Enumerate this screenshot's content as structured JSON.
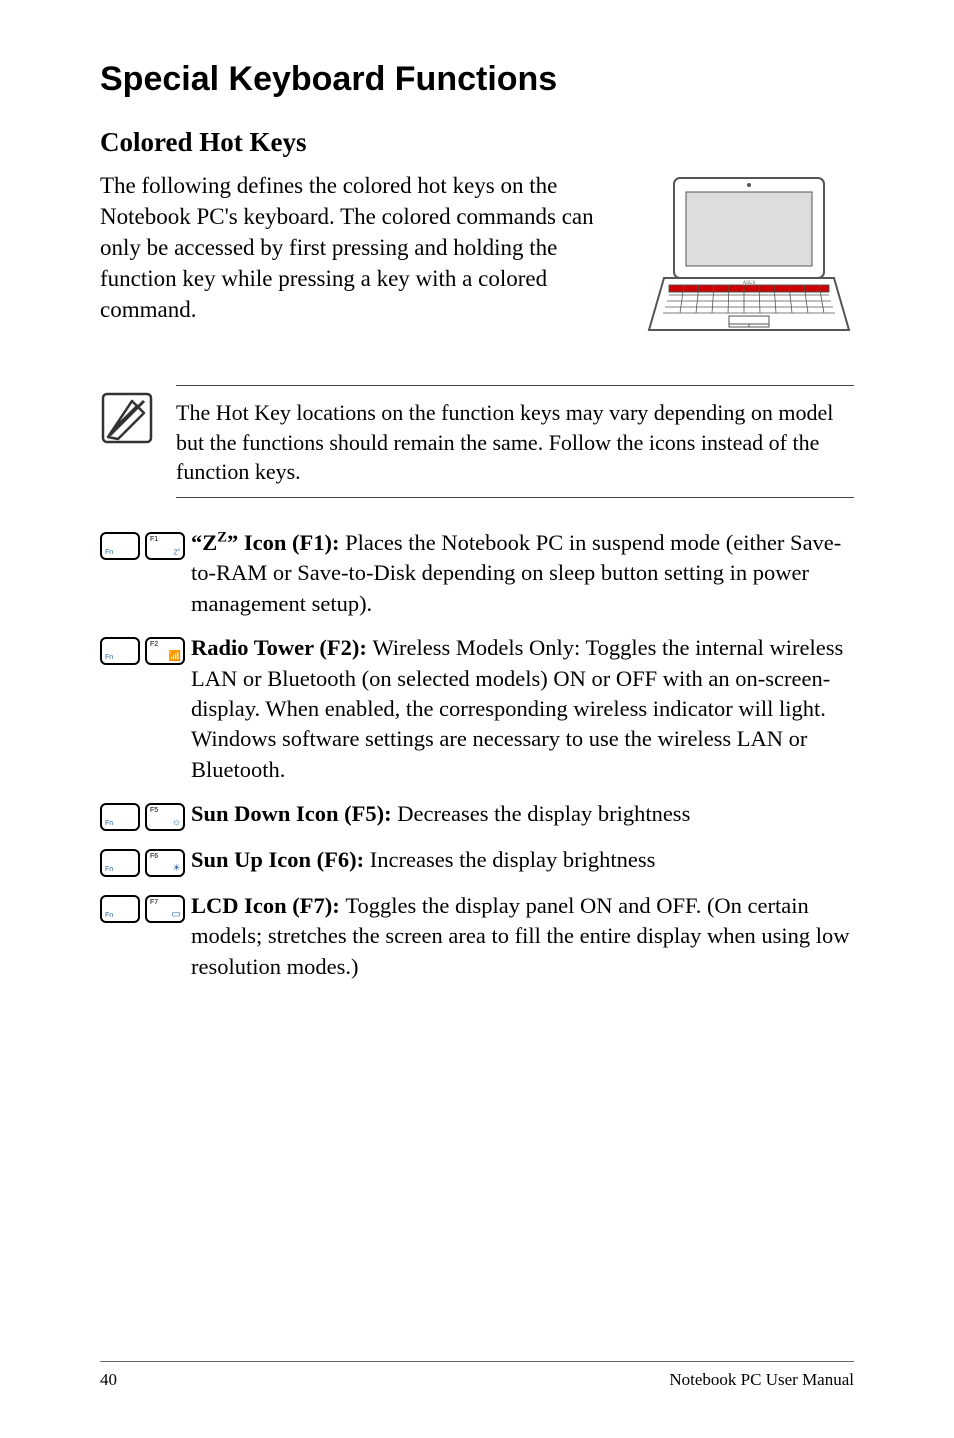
{
  "title": "Special Keyboard Functions",
  "subtitle": "Colored Hot Keys",
  "intro": "The following defines the colored hot keys on the Notebook PC's keyboard. The colored commands can only be accessed by first pressing and holding the function key while pressing a key with a colored command.",
  "note": "The Hot Key locations on the function keys may vary depending on model but the functions should remain the same. Follow the icons instead of the function keys.",
  "entries": {
    "f1": {
      "label": "F1",
      "sym": "Z",
      "bold": "\"ZZ\" Icon (F1): ",
      "text": "Places the Notebook PC in suspend mode (either Save-to-RAM or Save-to-Disk depending on sleep button setting in power management setup)."
    },
    "f2": {
      "label": "F2",
      "sym": "📡",
      "bold": "Radio Tower (F2): ",
      "text": "Wireless Models Only: Toggles the internal wireless LAN or Bluetooth (on selected models) ON or OFF with an on-screen-display. When enabled, the corresponding wireless indicator will light. Windows software settings are necessary to use the wireless LAN or Bluetooth."
    },
    "f5": {
      "label": "F5",
      "sym": "☼",
      "bold": "Sun Down Icon (F5): ",
      "text": "Decreases the display brightness"
    },
    "f6": {
      "label": "F6",
      "sym": "☀",
      "bold": "Sun Up Icon (F6): ",
      "text": "Increases the display brightness"
    },
    "f7": {
      "label": "F7",
      "sym": "▭",
      "bold": "LCD Icon (F7): ",
      "text": "Toggles the display panel ON and OFF. (On certain models; stretches the screen area to fill the entire display when using low resolution modes.)"
    }
  },
  "keys": {
    "fn": "Fn"
  },
  "footer": {
    "page": "40",
    "label": "Notebook PC User Manual"
  }
}
